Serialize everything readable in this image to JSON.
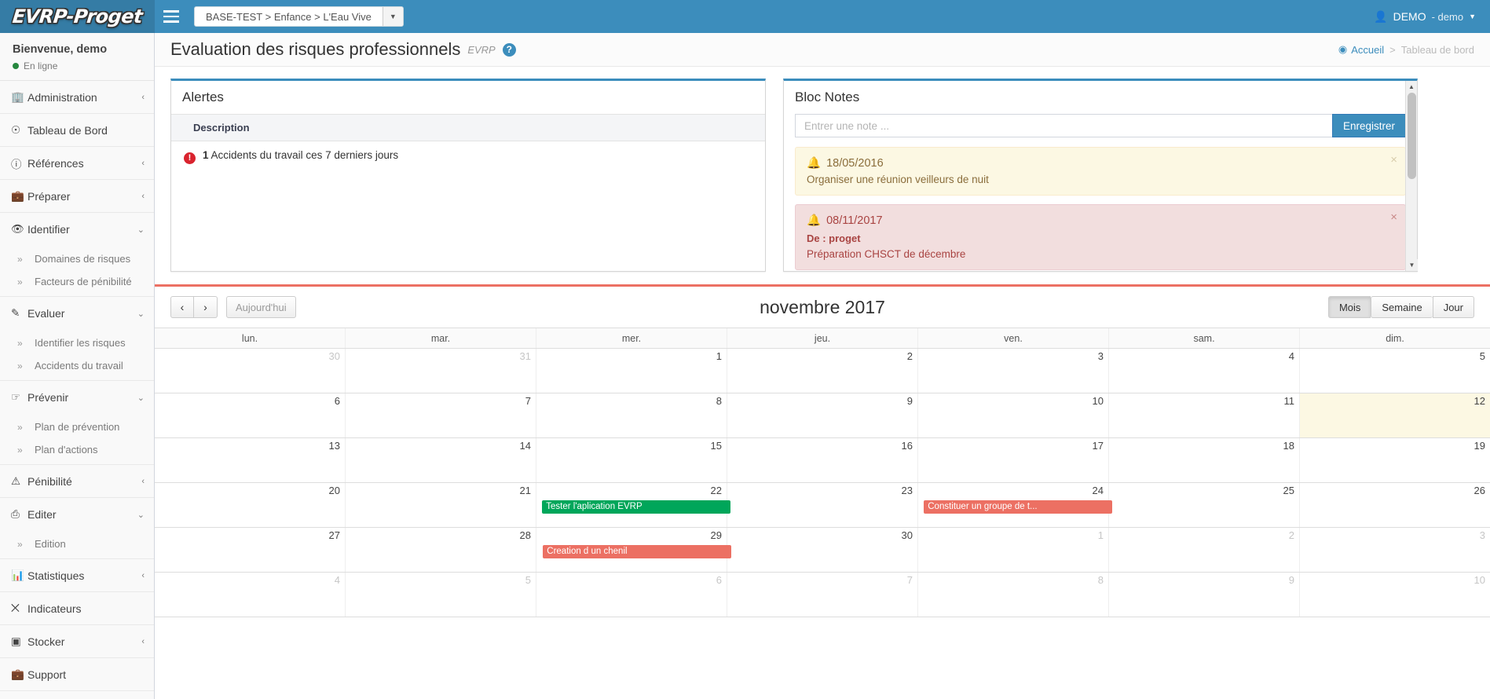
{
  "app": {
    "logo": "EVRP-Proget",
    "breadcrumb_select": "BASE-TEST > Enfance > L'Eau Vive",
    "user_name": "DEMO",
    "user_sub": "- demo",
    "caret": "▾"
  },
  "sidebar": {
    "welcome": "Bienvenue, demo",
    "status": "En ligne",
    "items": [
      {
        "label": "Administration",
        "icon": "🏢",
        "arrow": "‹",
        "subs": []
      },
      {
        "label": "Tableau de Bord",
        "icon": "☉",
        "arrow": "",
        "subs": []
      },
      {
        "label": "Références",
        "icon": "ⓘ",
        "arrow": "‹",
        "subs": []
      },
      {
        "label": "Préparer",
        "icon": "💼",
        "arrow": "‹",
        "subs": []
      },
      {
        "label": "Identifier",
        "icon": "👁",
        "arrow": "⌄",
        "subs": [
          "Domaines de risques",
          "Facteurs de pénibilité"
        ]
      },
      {
        "label": "Evaluer",
        "icon": "✎",
        "arrow": "⌄",
        "subs": [
          "Identifier les risques",
          "Accidents du travail"
        ]
      },
      {
        "label": "Prévenir",
        "icon": "☞",
        "arrow": "⌄",
        "subs": [
          "Plan de prévention",
          "Plan d'actions"
        ]
      },
      {
        "label": "Pénibilité",
        "icon": "⚠",
        "arrow": "‹",
        "subs": []
      },
      {
        "label": "Editer",
        "icon": "⎙",
        "arrow": "⌄",
        "subs": [
          "Edition"
        ]
      },
      {
        "label": "Statistiques",
        "icon": "📊",
        "arrow": "‹",
        "subs": []
      },
      {
        "label": "Indicateurs",
        "icon": "⨉",
        "arrow": "",
        "subs": []
      },
      {
        "label": "Stocker",
        "icon": "▣",
        "arrow": "‹",
        "subs": []
      },
      {
        "label": "Support",
        "icon": "💼",
        "arrow": "",
        "subs": []
      }
    ],
    "sub_chevron": "»"
  },
  "page": {
    "title": "Evaluation des risques professionnels",
    "subtitle": "EVRP",
    "help": "?",
    "crumb_home": "Accueil",
    "crumb_sep": ">",
    "crumb_current": "Tableau de bord"
  },
  "alertes": {
    "title": "Alertes",
    "column_header": "Description",
    "rows": [
      {
        "icon": "!",
        "count": "1",
        "text": "Accidents du travail ces 7 derniers jours"
      }
    ]
  },
  "blocnotes": {
    "title": "Bloc Notes",
    "input_placeholder": "Entrer une note ...",
    "input_value": "",
    "save_label": "Enregistrer",
    "bell": "🔔",
    "close": "×",
    "notes": [
      {
        "type": "warn",
        "date": "18/05/2016",
        "from": "",
        "body": "Organiser une réunion veilleurs de nuit"
      },
      {
        "type": "danger",
        "date": "08/11/2017",
        "from": "De : proget",
        "body": "Préparation CHSCT de décembre"
      }
    ]
  },
  "calendar": {
    "prev": "‹",
    "next": "›",
    "today_label": "Aujourd'hui",
    "month_title": "novembre 2017",
    "views": [
      {
        "label": "Mois",
        "active": true
      },
      {
        "label": "Semaine",
        "active": false
      },
      {
        "label": "Jour",
        "active": false
      }
    ],
    "day_headers": [
      "lun.",
      "mar.",
      "mer.",
      "jeu.",
      "ven.",
      "sam.",
      "dim."
    ],
    "weeks": [
      [
        {
          "day": "30",
          "other": true
        },
        {
          "day": "31",
          "other": true
        },
        {
          "day": "1"
        },
        {
          "day": "2"
        },
        {
          "day": "3"
        },
        {
          "day": "4"
        },
        {
          "day": "5"
        }
      ],
      [
        {
          "day": "6"
        },
        {
          "day": "7"
        },
        {
          "day": "8"
        },
        {
          "day": "9"
        },
        {
          "day": "10"
        },
        {
          "day": "11"
        },
        {
          "day": "12",
          "highlight": true
        }
      ],
      [
        {
          "day": "13"
        },
        {
          "day": "14"
        },
        {
          "day": "15"
        },
        {
          "day": "16"
        },
        {
          "day": "17"
        },
        {
          "day": "18"
        },
        {
          "day": "19"
        }
      ],
      [
        {
          "day": "20"
        },
        {
          "day": "21"
        },
        {
          "day": "22",
          "event": {
            "label": "Tester l'aplication EVRP",
            "color": "#00a65a",
            "span": 1
          }
        },
        {
          "day": "23"
        },
        {
          "day": "24",
          "event": {
            "label": "Constituer un groupe de t...",
            "color": "#ec7063",
            "span": 1
          }
        },
        {
          "day": "25"
        },
        {
          "day": "26"
        }
      ],
      [
        {
          "day": "27"
        },
        {
          "day": "28"
        },
        {
          "day": "29"
        },
        {
          "day": "30",
          "event": {
            "label": "Creation d un chenil",
            "color": "#ec7063",
            "span": 1,
            "offset": -1
          }
        },
        {
          "day": "1",
          "other": true
        },
        {
          "day": "2",
          "other": true
        },
        {
          "day": "3",
          "other": true
        }
      ],
      [
        {
          "day": "4",
          "other": true
        },
        {
          "day": "5",
          "other": true
        },
        {
          "day": "6",
          "other": true
        },
        {
          "day": "7",
          "other": true
        },
        {
          "day": "8",
          "other": true
        },
        {
          "day": "9",
          "other": true
        },
        {
          "day": "10",
          "other": true
        }
      ]
    ],
    "event_colors": {
      "green": "#00a65a",
      "red": "#ec7063"
    }
  },
  "colors": {
    "brand": "#3c8dbc",
    "brand_dark": "#357ca5",
    "accent_red": "#ec7063",
    "accent_green": "#00a65a",
    "alert_red": "#d9232e"
  }
}
